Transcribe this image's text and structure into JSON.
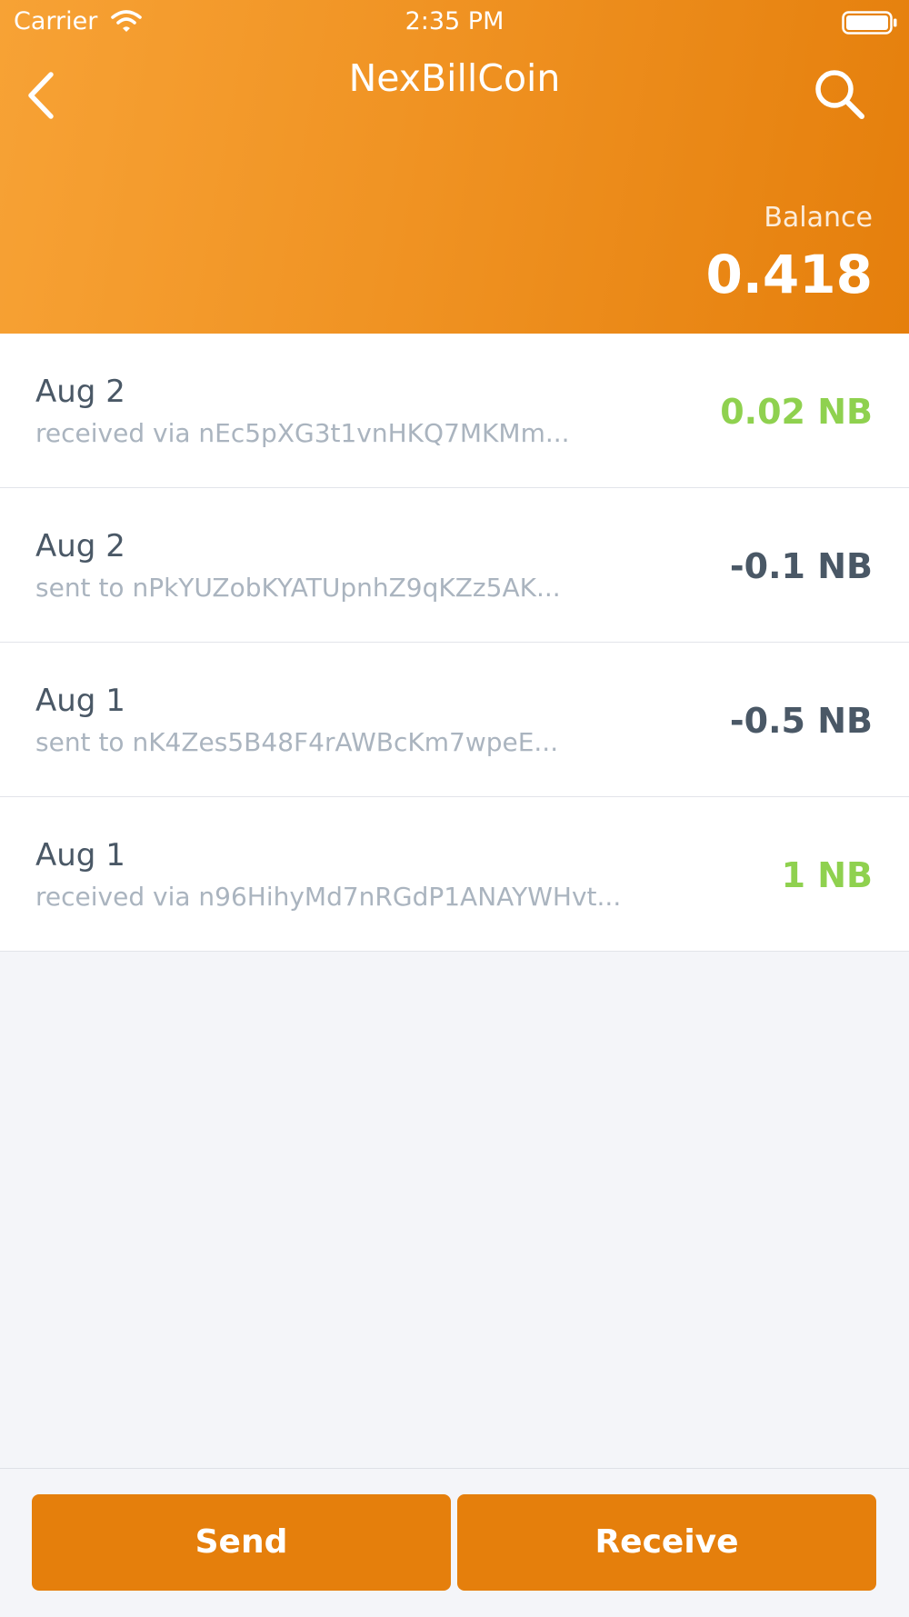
{
  "status_bar": {
    "carrier": "Carrier",
    "time": "2:35 PM"
  },
  "nav": {
    "title": "NexBillCoin",
    "back_icon": "chevron-left-icon",
    "search_icon": "search-icon"
  },
  "balance": {
    "label": "Balance",
    "value": "0.418"
  },
  "transactions": [
    {
      "date": "Aug 2",
      "description": "received via nEc5pXG3t1vnHKQ7MKMm...",
      "amount": "0.02 NB",
      "type": "received"
    },
    {
      "date": "Aug 2",
      "description": "sent to nPkYUZobKYATUpnhZ9qKZz5AK...",
      "amount": "-0.1 NB",
      "type": "sent"
    },
    {
      "date": "Aug 1",
      "description": "sent to nK4Zes5B48F4rAWBcKm7wpeE...",
      "amount": "-0.5 NB",
      "type": "sent"
    },
    {
      "date": "Aug 1",
      "description": "received via n96HihyMd7nRGdP1ANAYWHvt...",
      "amount": "1 NB",
      "type": "received"
    }
  ],
  "actions": {
    "send_label": "Send",
    "receive_label": "Receive"
  },
  "colors": {
    "accent": "#e57f0c",
    "received": "#8fd14f",
    "sent": "#4a5866"
  }
}
